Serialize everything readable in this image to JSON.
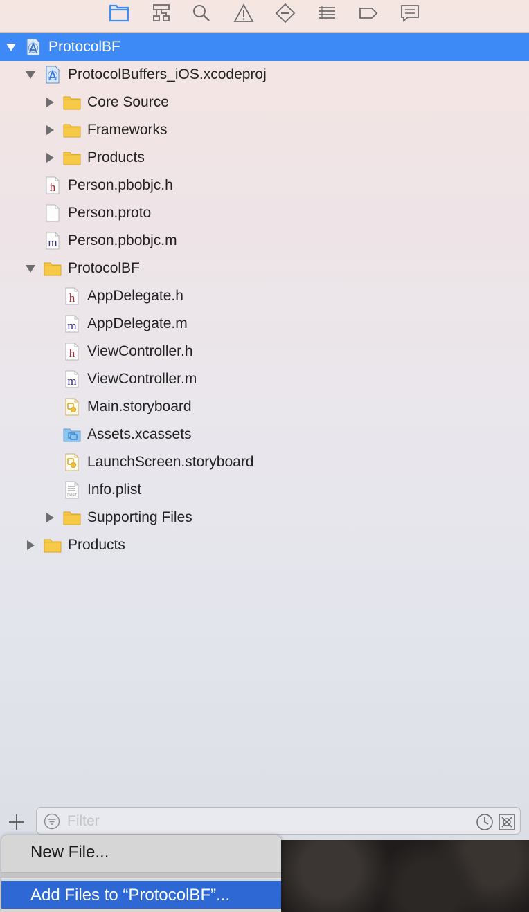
{
  "toolbar": {
    "icons": [
      "folder-icon",
      "hierarchy-icon",
      "search-icon",
      "warning-icon",
      "breakpoint-icon",
      "list-icon",
      "tag-icon",
      "comment-icon"
    ]
  },
  "tree": {
    "items": [
      {
        "label": "ProtocolBF",
        "icon": "xcodeproj-icon",
        "disclosure": "expanded",
        "selected": true
      },
      {
        "label": "ProtocolBuffers_iOS.xcodeproj",
        "icon": "xcodeproj-icon",
        "disclosure": "expanded"
      },
      {
        "label": "Core Source",
        "icon": "folder-icon",
        "disclosure": "collapsed"
      },
      {
        "label": "Frameworks",
        "icon": "folder-icon",
        "disclosure": "collapsed"
      },
      {
        "label": "Products",
        "icon": "folder-icon",
        "disclosure": "collapsed"
      },
      {
        "label": "Person.pbobjc.h",
        "icon": "header-file-icon",
        "glyph": "h"
      },
      {
        "label": "Person.proto",
        "icon": "blank-file-icon"
      },
      {
        "label": "Person.pbobjc.m",
        "icon": "source-file-icon",
        "glyph": "m"
      },
      {
        "label": "ProtocolBF",
        "icon": "folder-icon",
        "disclosure": "expanded"
      },
      {
        "label": "AppDelegate.h",
        "icon": "header-file-icon",
        "glyph": "h"
      },
      {
        "label": "AppDelegate.m",
        "icon": "source-file-icon",
        "glyph": "m"
      },
      {
        "label": "ViewController.h",
        "icon": "header-file-icon",
        "glyph": "h"
      },
      {
        "label": "ViewController.m",
        "icon": "source-file-icon",
        "glyph": "m"
      },
      {
        "label": "Main.storyboard",
        "icon": "storyboard-icon"
      },
      {
        "label": "Assets.xcassets",
        "icon": "assets-folder-icon"
      },
      {
        "label": "LaunchScreen.storyboard",
        "icon": "storyboard-icon"
      },
      {
        "label": "Info.plist",
        "icon": "plist-icon",
        "glyph": "PLIST"
      },
      {
        "label": "Supporting Files",
        "icon": "folder-icon",
        "disclosure": "collapsed"
      },
      {
        "label": "Products",
        "icon": "folder-icon",
        "disclosure": "collapsed"
      }
    ]
  },
  "filter": {
    "placeholder": "Filter"
  },
  "menu": {
    "new_file": "New File...",
    "add_files": "Add Files to “ProtocolBF”..."
  },
  "colors": {
    "selection": "#3d8af7",
    "menu_highlight": "#2d68d4",
    "folder": "#f7c948",
    "header_glyph": "#a8242c",
    "source_glyph": "#3c2d7a"
  }
}
